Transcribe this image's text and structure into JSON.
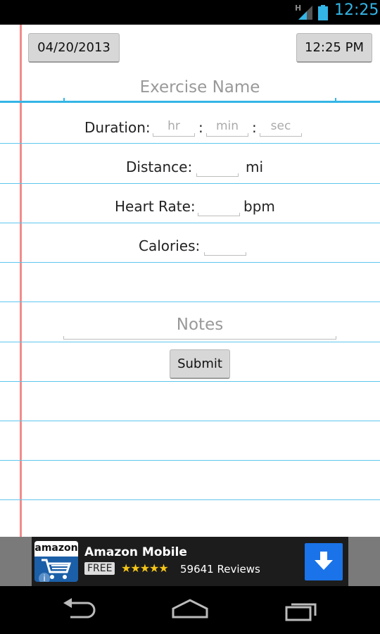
{
  "status_bar": {
    "network_type": "H",
    "time": "12:25"
  },
  "header": {
    "date_button": "04/20/2013",
    "time_button": "12:25 PM",
    "exercise_name_placeholder": "Exercise Name"
  },
  "form": {
    "duration_label": "Duration:",
    "hr_placeholder": "hr",
    "min_placeholder": "min",
    "sec_placeholder": "sec",
    "colon1": ":",
    "colon2": ":",
    "distance_label": "Distance:",
    "distance_unit": "mi",
    "heart_rate_label": "Heart Rate:",
    "heart_rate_unit": "bpm",
    "calories_label": "Calories:",
    "notes_placeholder": "Notes",
    "submit_label": "Submit"
  },
  "ad": {
    "logo_text": "amazon",
    "title": "Amazon Mobile",
    "price": "FREE",
    "stars": "★★★★★",
    "rating": 4.5,
    "reviews": "59641 Reviews",
    "info_glyph": "i"
  },
  "colors": {
    "accent": "#33b5e5",
    "margin_line": "#f28b8b",
    "rule": "#5ec6ee",
    "ad_download": "#1a73e8"
  },
  "icons": [
    "signal-icon",
    "battery-icon",
    "shopping-cart-icon",
    "download-icon",
    "info-icon",
    "back-icon",
    "home-icon",
    "recent-apps-icon"
  ]
}
